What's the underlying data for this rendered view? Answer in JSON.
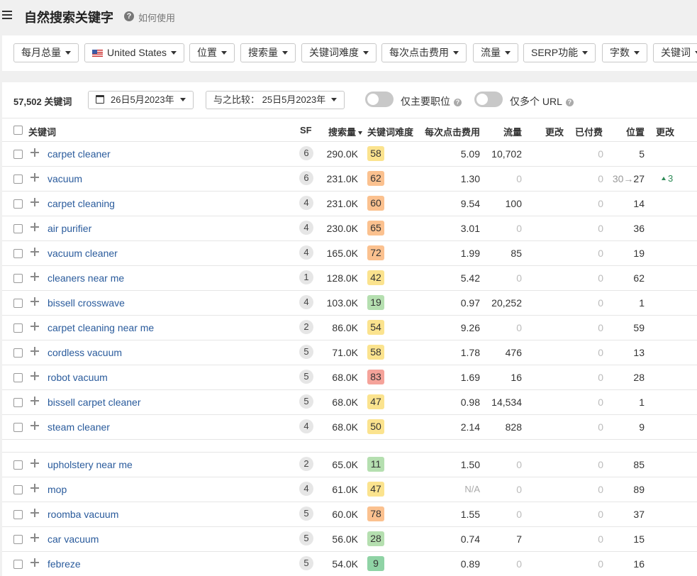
{
  "header": {
    "title": "自然搜索关键字",
    "help_label": "如何使用"
  },
  "filters": [
    {
      "label": "每月总量"
    },
    {
      "label": "United States",
      "flag": true
    },
    {
      "label": "位置"
    },
    {
      "label": "搜索量"
    },
    {
      "label": "关键词难度"
    },
    {
      "label": "每次点击费用"
    },
    {
      "label": "流量"
    },
    {
      "label": "SERP功能"
    },
    {
      "label": "字数"
    },
    {
      "label": "关键词"
    }
  ],
  "summary": {
    "count": "57,502 关键词",
    "date": "26日5月2023年",
    "compare": "与之比较： 25日5月2023年",
    "toggle_main_positions": "仅主要职位",
    "toggle_multi_url": "仅多个 URL"
  },
  "columns": {
    "keyword": "关键词",
    "sf": "SF",
    "volume": "搜索量",
    "kd": "关键词难度",
    "cpc": "每次点击费用",
    "traffic": "流量",
    "traffic_change": "更改",
    "paid": "已付费",
    "position": "位置",
    "position_change": "更改"
  },
  "colors": {
    "kd_easy": "#b5dfb0",
    "kd_mid": "#fbe38e",
    "kd_hard": "#fbc18f",
    "kd_veryhard": "#f5a39a",
    "link": "#2a5b9c",
    "up": "#2e8b57"
  },
  "rows": [
    {
      "keyword": "carpet cleaner",
      "sf": "6",
      "volume": "290.0K",
      "kd": "58",
      "kd_color": "#fbe38e",
      "cpc": "5.09",
      "traffic": "10,702",
      "paid": "0",
      "position": "5"
    },
    {
      "keyword": "vacuum",
      "sf": "6",
      "volume": "231.0K",
      "kd": "62",
      "kd_color": "#fbc18f",
      "cpc": "1.30",
      "traffic": "0",
      "paid": "0",
      "position": "27",
      "position_prev": "30",
      "position_change": "3"
    },
    {
      "keyword": "carpet cleaning",
      "sf": "4",
      "volume": "231.0K",
      "kd": "60",
      "kd_color": "#fbc18f",
      "cpc": "9.54",
      "traffic": "100",
      "paid": "0",
      "position": "14"
    },
    {
      "keyword": "air purifier",
      "sf": "4",
      "volume": "230.0K",
      "kd": "65",
      "kd_color": "#fbc18f",
      "cpc": "3.01",
      "traffic": "0",
      "paid": "0",
      "position": "36"
    },
    {
      "keyword": "vacuum cleaner",
      "sf": "4",
      "volume": "165.0K",
      "kd": "72",
      "kd_color": "#fbc18f",
      "cpc": "1.99",
      "traffic": "85",
      "paid": "0",
      "position": "19"
    },
    {
      "keyword": "cleaners near me",
      "sf": "1",
      "volume": "128.0K",
      "kd": "42",
      "kd_color": "#fbe38e",
      "cpc": "5.42",
      "traffic": "0",
      "paid": "0",
      "position": "62"
    },
    {
      "keyword": "bissell crosswave",
      "sf": "4",
      "volume": "103.0K",
      "kd": "19",
      "kd_color": "#b5dfb0",
      "cpc": "0.97",
      "traffic": "20,252",
      "paid": "0",
      "position": "1"
    },
    {
      "keyword": "carpet cleaning near me",
      "sf": "2",
      "volume": "86.0K",
      "kd": "54",
      "kd_color": "#fbe38e",
      "cpc": "9.26",
      "traffic": "0",
      "paid": "0",
      "position": "59"
    },
    {
      "keyword": "cordless vacuum",
      "sf": "5",
      "volume": "71.0K",
      "kd": "58",
      "kd_color": "#fbe38e",
      "cpc": "1.78",
      "traffic": "476",
      "paid": "0",
      "position": "13"
    },
    {
      "keyword": "robot vacuum",
      "sf": "5",
      "volume": "68.0K",
      "kd": "83",
      "kd_color": "#f5a39a",
      "cpc": "1.69",
      "traffic": "16",
      "paid": "0",
      "position": "28"
    },
    {
      "keyword": "bissell carpet cleaner",
      "sf": "5",
      "volume": "68.0K",
      "kd": "47",
      "kd_color": "#fbe38e",
      "cpc": "0.98",
      "traffic": "14,534",
      "paid": "0",
      "position": "1"
    },
    {
      "keyword": "steam cleaner",
      "sf": "4",
      "volume": "68.0K",
      "kd": "50",
      "kd_color": "#fbe38e",
      "cpc": "2.14",
      "traffic": "828",
      "paid": "0",
      "position": "9"
    },
    {
      "keyword": "upholstery near me",
      "sf": "2",
      "volume": "65.0K",
      "kd": "11",
      "kd_color": "#b5dfb0",
      "cpc": "1.50",
      "traffic": "0",
      "paid": "0",
      "position": "85"
    },
    {
      "keyword": "mop",
      "sf": "4",
      "volume": "61.0K",
      "kd": "47",
      "kd_color": "#fbe38e",
      "cpc": "N/A",
      "traffic": "0",
      "paid": "0",
      "position": "89"
    },
    {
      "keyword": "roomba vacuum",
      "sf": "5",
      "volume": "60.0K",
      "kd": "78",
      "kd_color": "#fbc18f",
      "cpc": "1.55",
      "traffic": "0",
      "paid": "0",
      "position": "37"
    },
    {
      "keyword": "car vacuum",
      "sf": "5",
      "volume": "56.0K",
      "kd": "28",
      "kd_color": "#b5dfb0",
      "cpc": "0.74",
      "traffic": "7",
      "paid": "0",
      "position": "15"
    },
    {
      "keyword": "febreze",
      "sf": "5",
      "volume": "54.0K",
      "kd": "9",
      "kd_color": "#8fd3a5",
      "cpc": "0.89",
      "traffic": "0",
      "paid": "0",
      "position": "16"
    }
  ]
}
